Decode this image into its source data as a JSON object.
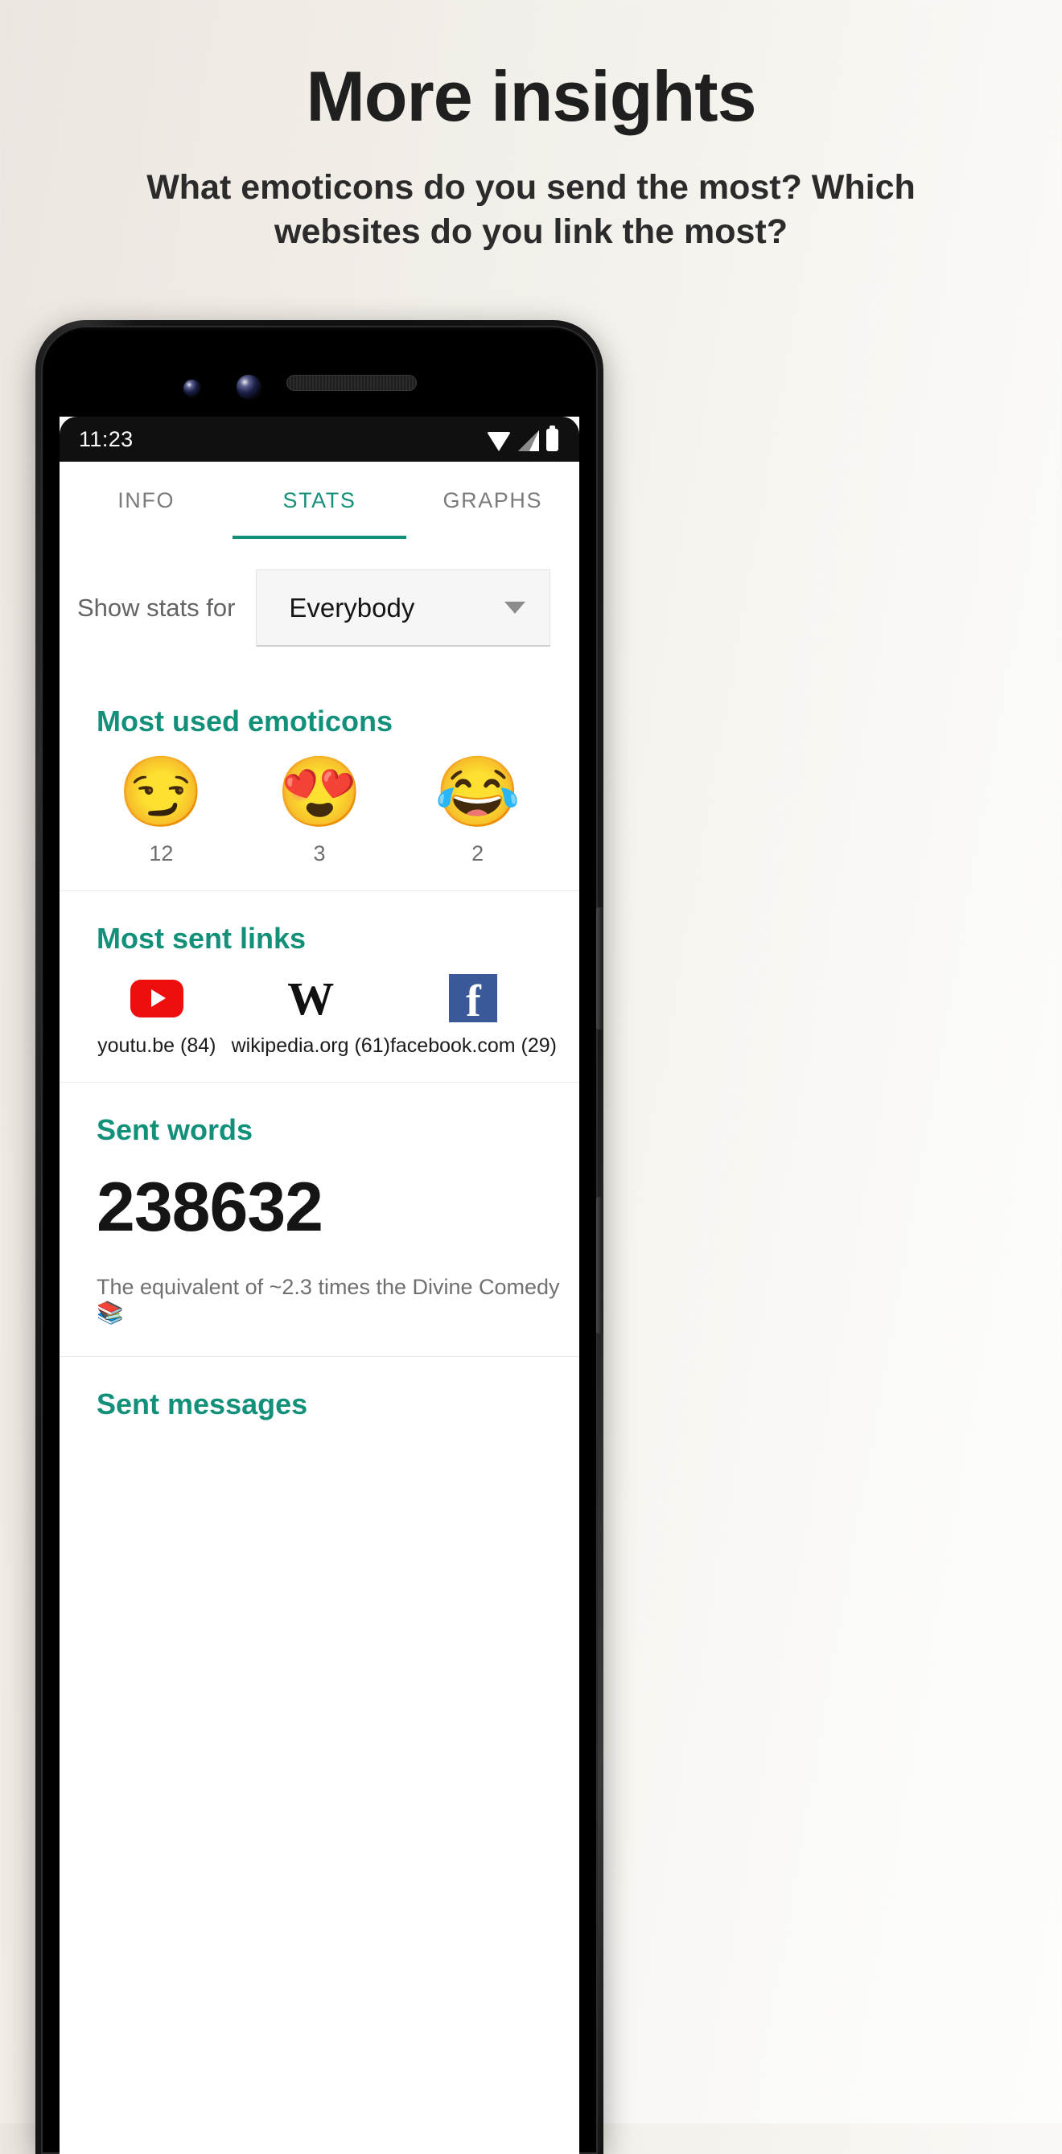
{
  "promo": {
    "title": "More insights",
    "subtitle": "What emoticons do you send the most? Which websites do you link the most?"
  },
  "phone": {
    "status_bar": {
      "time": "11:23",
      "icons": [
        "wifi-icon",
        "signal-icon",
        "battery-icon"
      ]
    },
    "tabs": [
      {
        "label": "INFO",
        "active": false
      },
      {
        "label": "STATS",
        "active": true
      },
      {
        "label": "GRAPHS",
        "active": false
      }
    ],
    "filter": {
      "label": "Show stats for",
      "value": "Everybody",
      "caret": "chevron-down-icon"
    },
    "sections": {
      "emoticons": {
        "title": "Most used emoticons",
        "items": [
          {
            "emoji": "😏",
            "name": "smirking-face",
            "count": "12"
          },
          {
            "emoji": "😍",
            "name": "heart-eyes-face",
            "count": "3"
          },
          {
            "emoji": "😂",
            "name": "tears-of-joy-face",
            "count": "2"
          }
        ]
      },
      "links": {
        "title": "Most sent links",
        "items": [
          {
            "icon": "youtube-logo",
            "label": "youtu.be (84)"
          },
          {
            "icon": "wikipedia-logo",
            "glyph": "W",
            "label": "wikipedia.org (61)"
          },
          {
            "icon": "facebook-logo",
            "glyph": "f",
            "label": "facebook.com (29)"
          }
        ]
      },
      "sent_words": {
        "title": "Sent words",
        "value": "238632",
        "note": "The equivalent of ~2.3 times the Divine Comedy 📚"
      },
      "sent_messages": {
        "title": "Sent messages"
      }
    }
  },
  "colors": {
    "accent": "#13907a",
    "text_dark": "#151515",
    "text_muted": "#707070",
    "youtube_red": "#ef0e0e",
    "facebook_blue": "#3b5998"
  }
}
